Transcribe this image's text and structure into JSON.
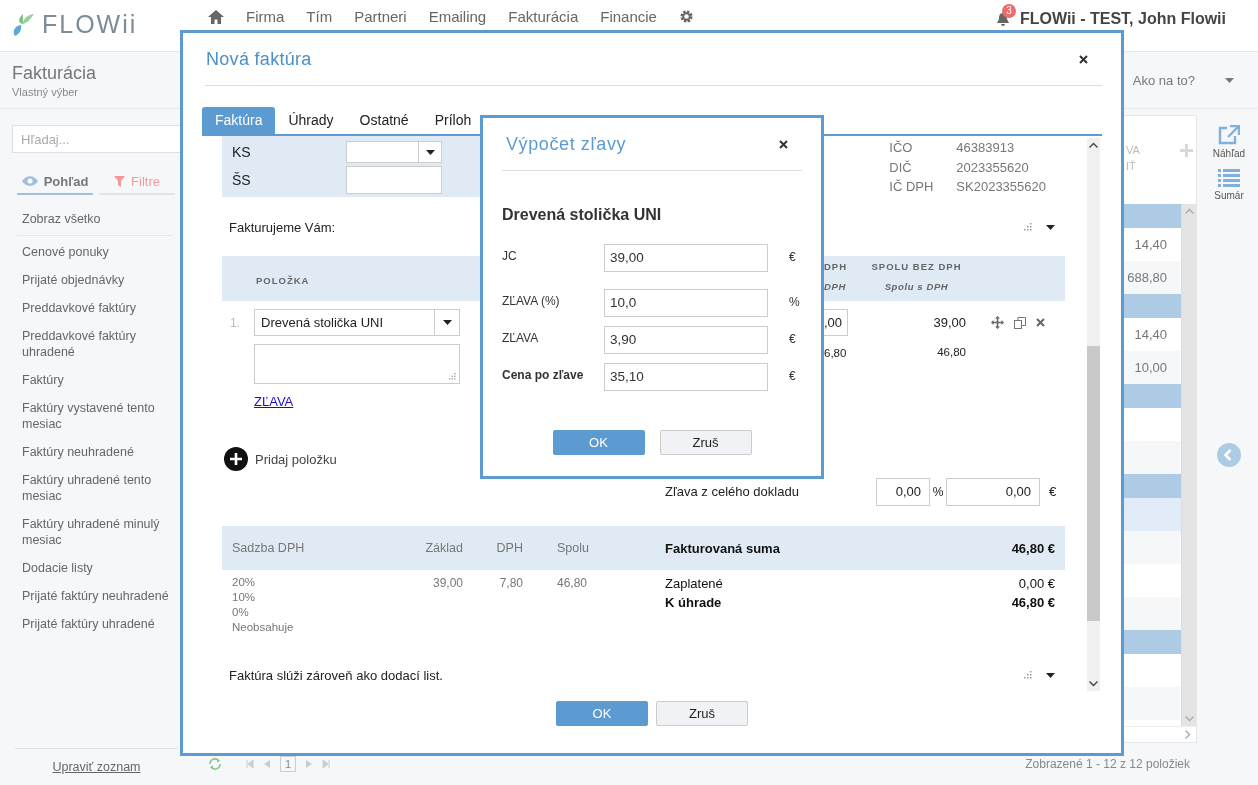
{
  "app_header": {
    "logo": "FLOWii",
    "nav": [
      "Firma",
      "Tím",
      "Partneri",
      "Emailing",
      "Fakturácia",
      "Financie"
    ],
    "notification_count": "3",
    "user": "FLOWii - TEST, John Flowii"
  },
  "subheader": {
    "title": "Fakturácia",
    "subtitle": "Vlastný výber",
    "help": "Ako na to?"
  },
  "sidebar": {
    "search": {
      "placeholder": "Hľadaj..."
    },
    "tabs": [
      {
        "label": "Pohľad",
        "kind": "view",
        "selected": true
      },
      {
        "label": "Filtre",
        "kind": "filter",
        "selected": false
      }
    ],
    "items": [
      "Zobraz všetko",
      "Cenové ponuky",
      "Prijaté objednávky",
      "Preddavkové faktúry",
      "Preddavkové faktúry uhradené",
      "Faktúry",
      "Faktúry vystavené tento mesiac",
      "Faktúry neuhradené",
      "Faktúry uhradené tento mesiac",
      "Faktúry uhradené minulý mesiac",
      "Dodacie listy",
      "Prijaté faktúry neuhradené",
      "Prijaté faktúry uhradené"
    ],
    "footer_link": "Upraviť zoznam"
  },
  "grid": {
    "header_fragments": [
      "VA",
      "IŤ"
    ],
    "rows": [
      {
        "kind": "group"
      },
      {
        "kind": "item",
        "value": "14,40",
        "selected": false
      },
      {
        "kind": "item",
        "value": "688,80",
        "selected": false
      },
      {
        "kind": "group"
      },
      {
        "kind": "item",
        "value": "14,40",
        "selected": false
      },
      {
        "kind": "item",
        "value": "10,00",
        "selected": false
      },
      {
        "kind": "group"
      },
      {
        "kind": "item",
        "selected": false
      },
      {
        "kind": "item",
        "selected": false
      },
      {
        "kind": "group"
      },
      {
        "kind": "item",
        "selected": true
      },
      {
        "kind": "item",
        "selected": false
      },
      {
        "kind": "item",
        "selected": false
      },
      {
        "kind": "item",
        "selected": false
      },
      {
        "kind": "group"
      },
      {
        "kind": "item",
        "selected": false
      },
      {
        "kind": "item",
        "selected": false
      }
    ],
    "side_actions": [
      {
        "label": "Náhľad",
        "kind": "preview"
      },
      {
        "label": "Sumár",
        "kind": "summary"
      }
    ],
    "pager": {
      "page": "1",
      "summary": "Zobrazené 1 - 12 z 12 položiek"
    }
  },
  "invoice_modal": {
    "title": "Nová faktúra",
    "tabs": [
      {
        "label": "Faktúra",
        "selected": true
      },
      {
        "label": "Úhrady",
        "selected": false
      },
      {
        "label": "Ostatné",
        "selected": false
      },
      {
        "label": "Príloh",
        "selected": false
      }
    ],
    "ks_label": "KS",
    "ss_label": "ŠS",
    "supplier": [
      {
        "label": "IČO",
        "value": "46383913"
      },
      {
        "label": "DIČ",
        "value": "2023355620"
      },
      {
        "label": "IČ DPH",
        "value": "SK2023355620"
      }
    ],
    "billing_label": "Fakturujeme Vám:",
    "items_header": {
      "item": "POLOŽKA",
      "column_3": "DPH",
      "column_3_sub": "DPH",
      "total": "SPOLU BEZ DPH",
      "total_sub": "Spolu s DPH"
    },
    "items": [
      {
        "number": "1.",
        "name": "Drevená stolička UNI",
        "column_3": ",00",
        "column_3_sub": "6,80",
        "total": "39,00",
        "total_sub": "46,80",
        "discount_link": "ZĽAVA"
      }
    ],
    "add_item": "Pridaj položku",
    "document_discount": {
      "label": "Zľava z celého dokladu",
      "percent": "0,00",
      "percent_unit": "%",
      "amount": "0,00",
      "amount_unit": "€"
    },
    "vat_table": {
      "columns": [
        "Sadzba DPH",
        "Základ",
        "DPH",
        "Spolu"
      ],
      "rates": [
        "20%",
        "10%",
        "0%",
        "Neobsahuje"
      ],
      "values": [
        "39,00",
        "7,80",
        "46,80"
      ]
    },
    "totals": {
      "invoiced_label": "Fakturovaná suma",
      "invoiced": "46,80 €",
      "paid_label": "Zaplatené",
      "paid": "0,00 €",
      "due_label": "K úhrade",
      "due": "46,80 €"
    },
    "delivery_note": "Faktúra slúži zároveň ako dodací list.",
    "buttons": [
      {
        "label": "OK",
        "kind": "primary"
      },
      {
        "label": "Zruš",
        "kind": "secondary"
      }
    ]
  },
  "discount_dialog": {
    "title": "Výpočet zľavy",
    "product": "Drevená stolička UNI",
    "fields": [
      {
        "label": "JC",
        "value": "39,00",
        "unit": "€",
        "emphasis": false
      },
      {
        "label": "ZĽAVA (%)",
        "value": "10,0",
        "unit": "%",
        "emphasis": false
      },
      {
        "label": "ZĽAVA",
        "value": "3,90",
        "unit": "€",
        "emphasis": false
      },
      {
        "label": "Cena po zľave",
        "value": "35,10",
        "unit": "€",
        "emphasis": true
      }
    ],
    "buttons": [
      {
        "label": "OK",
        "kind": "primary"
      },
      {
        "label": "Zruš",
        "kind": "secondary"
      }
    ]
  }
}
